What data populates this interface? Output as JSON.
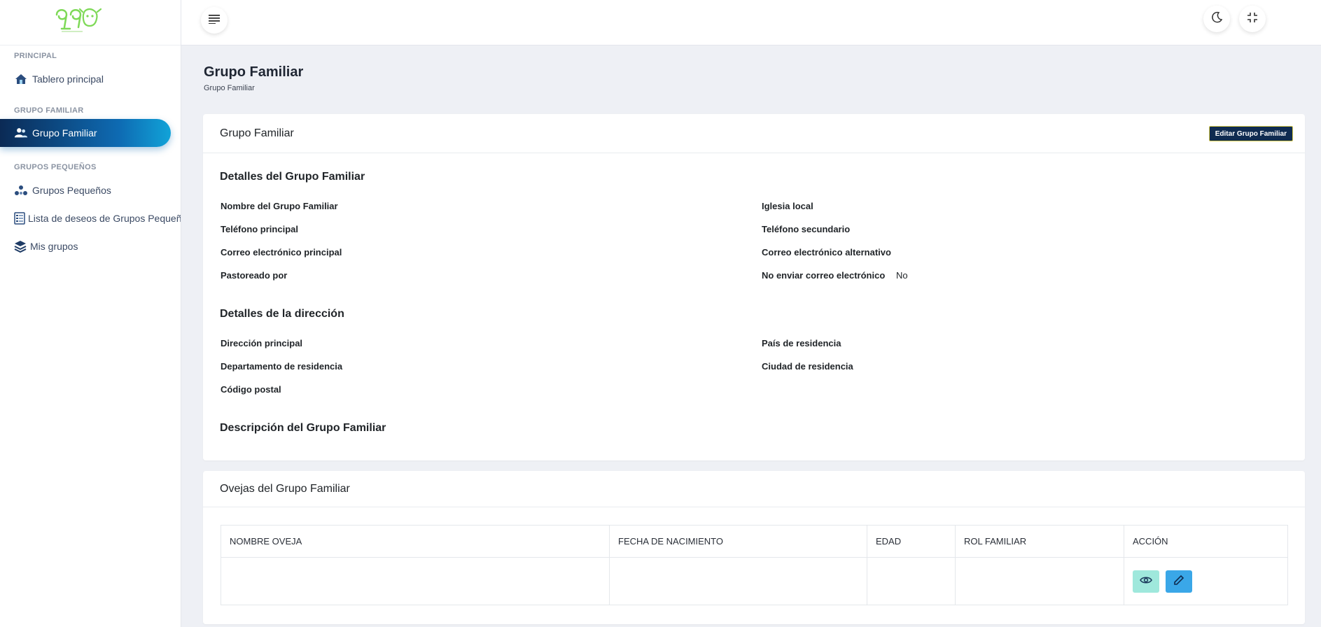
{
  "sidebar": {
    "sections": [
      {
        "title": "PRINCIPAL",
        "items": [
          {
            "label": "Tablero principal",
            "icon": "home-icon"
          }
        ]
      },
      {
        "title": "GRUPO FAMILIAR",
        "items": [
          {
            "label": "Grupo Familiar",
            "icon": "users-icon"
          }
        ]
      },
      {
        "title": "GRUPOS PEQUEÑOS",
        "items": [
          {
            "label": "Grupos Pequeños",
            "icon": "group-dots-icon"
          },
          {
            "label": "Lista de deseos de Grupos Pequeños",
            "icon": "list-icon"
          },
          {
            "label": "Mis grupos",
            "icon": "layers-icon"
          }
        ]
      }
    ]
  },
  "topbar": {
    "menu_icon": "menu-icon",
    "theme_icon": "moon-icon",
    "fullscreen_icon": "minimize-icon"
  },
  "page": {
    "title": "Grupo Familiar",
    "breadcrumb": "Grupo Familiar"
  },
  "details_card": {
    "header": "Grupo Familiar",
    "edit_button": "Editar Grupo Familiar",
    "details_title": "Detalles del Grupo Familiar",
    "fields": {
      "nombre": "Nombre del Grupo Familiar",
      "iglesia": "Iglesia local",
      "tel_principal": "Teléfono principal",
      "tel_secundario": "Teléfono secundario",
      "correo_principal": "Correo electrónico principal",
      "correo_alternativo": "Correo electrónico alternativo",
      "pastoreado": "Pastoreado por",
      "no_enviar": "No enviar correo electrónico",
      "no_enviar_value": "No"
    },
    "address_title": "Detalles de la dirección",
    "address_fields": {
      "direccion": "Dirección principal",
      "pais": "País de residencia",
      "departamento": "Departamento de residencia",
      "ciudad": "Ciudad de residencia",
      "postal": "Código postal"
    },
    "description_title": "Descripción del Grupo Familiar"
  },
  "sheep_card": {
    "header": "Ovejas del Grupo Familiar",
    "columns": [
      "NOMBRE OVEJA",
      "FECHA DE NACIMIENTO",
      "EDAD",
      "ROL FAMILIAR",
      "ACCIÓN"
    ],
    "actions": {
      "view_icon": "eye-icon",
      "edit_icon": "pencil-icon",
      "view_color": "#9fe8dc",
      "edit_color": "#3aa7e8"
    }
  },
  "colors": {
    "accent": "#0e6bb3",
    "button_dark": "#0f2b50",
    "logo_green": "#7ed957"
  }
}
